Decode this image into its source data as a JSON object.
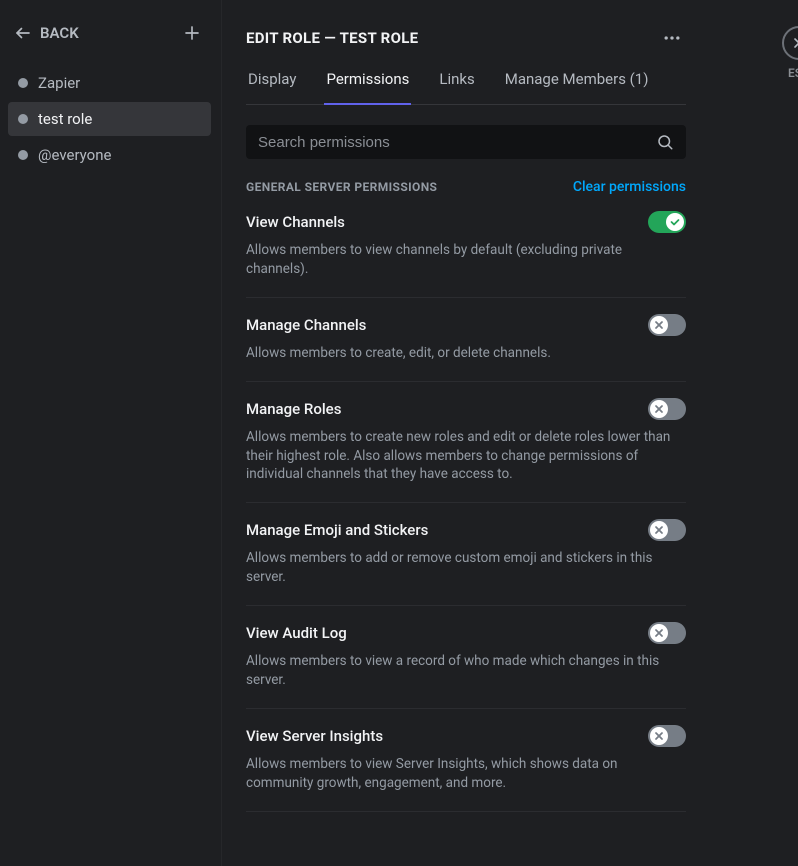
{
  "header": {
    "back_label": "BACK",
    "title": "EDIT ROLE — TEST ROLE",
    "esc_label": "ESC"
  },
  "roles": {
    "items": [
      {
        "label": "Zapier",
        "selected": false
      },
      {
        "label": "test role",
        "selected": true
      },
      {
        "label": "@everyone",
        "selected": false
      }
    ]
  },
  "tabs": [
    {
      "label": "Display",
      "active": false
    },
    {
      "label": "Permissions",
      "active": true
    },
    {
      "label": "Links",
      "active": false
    },
    {
      "label": "Manage Members (1)",
      "active": false
    }
  ],
  "search": {
    "placeholder": "Search permissions"
  },
  "section": {
    "title": "GENERAL SERVER PERMISSIONS",
    "clear_label": "Clear permissions"
  },
  "permissions": [
    {
      "title": "View Channels",
      "desc": "Allows members to view channels by default (excluding private channels).",
      "enabled": true
    },
    {
      "title": "Manage Channels",
      "desc": "Allows members to create, edit, or delete channels.",
      "enabled": false
    },
    {
      "title": "Manage Roles",
      "desc": "Allows members to create new roles and edit or delete roles lower than their highest role. Also allows members to change permissions of individual channels that they have access to.",
      "enabled": false
    },
    {
      "title": "Manage Emoji and Stickers",
      "desc": "Allows members to add or remove custom emoji and stickers in this server.",
      "enabled": false
    },
    {
      "title": "View Audit Log",
      "desc": "Allows members to view a record of who made which changes in this server.",
      "enabled": false
    },
    {
      "title": "View Server Insights",
      "desc": "Allows members to view Server Insights, which shows data on community growth, engagement, and more.",
      "enabled": false
    }
  ]
}
